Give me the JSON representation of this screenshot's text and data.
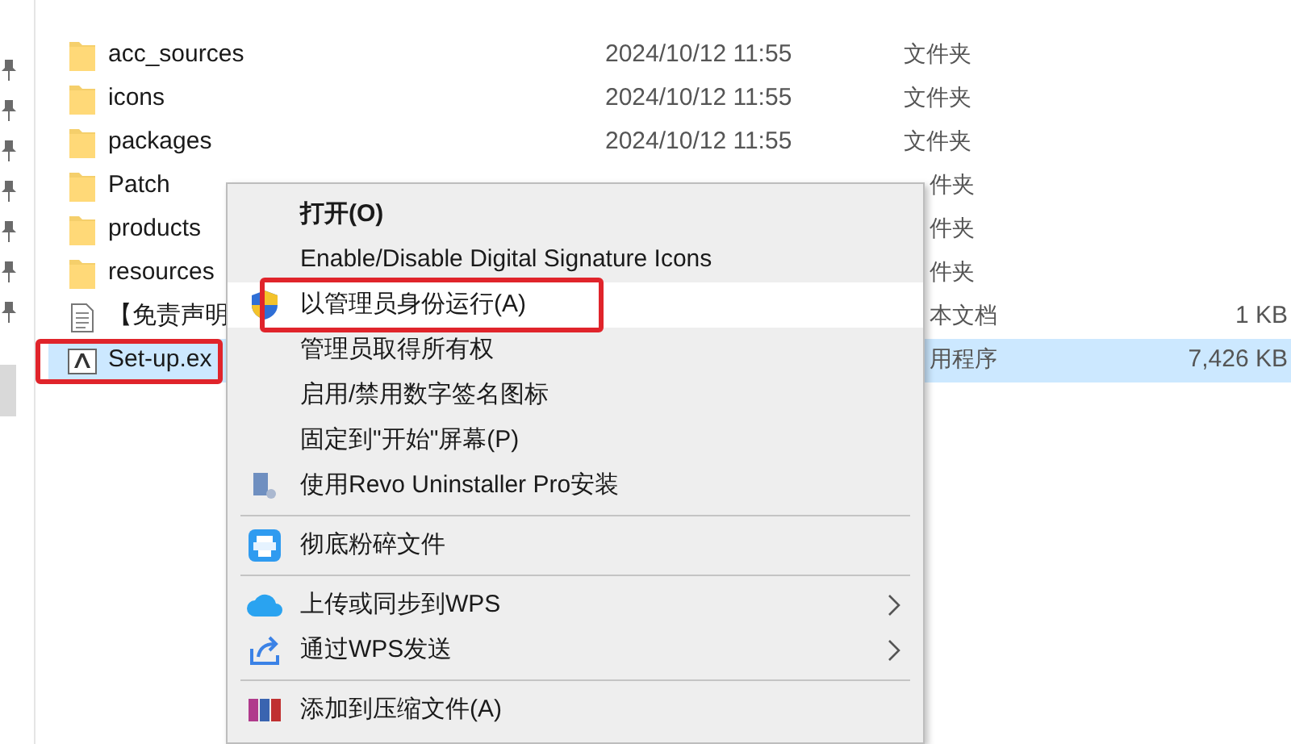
{
  "files": [
    {
      "kind": "folder",
      "name": "acc_sources",
      "date": "2024/10/12 11:55",
      "type": "文件夹",
      "selected": false,
      "highlighted": false
    },
    {
      "kind": "folder",
      "name": "icons",
      "date": "2024/10/12 11:55",
      "type": "文件夹",
      "selected": false,
      "highlighted": false
    },
    {
      "kind": "folder",
      "name": "packages",
      "date": "2024/10/12 11:55",
      "type": "文件夹",
      "selected": false,
      "highlighted": false
    },
    {
      "kind": "folder",
      "name": "Patch",
      "type": "件夹",
      "selected": false,
      "highlighted": false
    },
    {
      "kind": "folder",
      "name": "products",
      "type": "件夹",
      "selected": false,
      "highlighted": false
    },
    {
      "kind": "folder",
      "name": "resources",
      "type": "件夹",
      "selected": false,
      "highlighted": false
    },
    {
      "kind": "text",
      "name": "【免责声明",
      "type": "本文档",
      "size": "1 KB",
      "selected": false,
      "highlighted": false
    },
    {
      "kind": "app",
      "name": "Set-up.ex",
      "type": "用程序",
      "size": "7,426 KB",
      "selected": true,
      "highlighted": true
    }
  ],
  "context_menu": [
    {
      "kind": "plain",
      "label": "打开(O)",
      "default": true,
      "selected": false,
      "highlighted": false,
      "submenu": false
    },
    {
      "kind": "plain",
      "label": "Enable/Disable Digital Signature Icons",
      "default": false,
      "selected": false,
      "highlighted": false,
      "submenu": false
    },
    {
      "kind": "shield",
      "label": "以管理员身份运行(A)",
      "default": false,
      "selected": true,
      "highlighted": true,
      "submenu": false
    },
    {
      "kind": "plain",
      "label": "管理员取得所有权",
      "default": false,
      "selected": false,
      "highlighted": false,
      "submenu": false
    },
    {
      "kind": "plain",
      "label": "启用/禁用数字签名图标",
      "default": false,
      "selected": false,
      "highlighted": false,
      "submenu": false
    },
    {
      "kind": "plain",
      "label": "固定到\"开始\"屏幕(P)",
      "default": false,
      "selected": false,
      "highlighted": false,
      "submenu": false
    },
    {
      "kind": "installer",
      "label": "使用Revo Uninstaller Pro安装",
      "default": false,
      "selected": false,
      "highlighted": false,
      "submenu": false
    },
    {
      "kind": "separator"
    },
    {
      "kind": "shredder",
      "label": "彻底粉碎文件",
      "default": false,
      "selected": false,
      "highlighted": false,
      "submenu": false
    },
    {
      "kind": "separator"
    },
    {
      "kind": "cloud",
      "label": "上传或同步到WPS",
      "submenu": true,
      "default": false,
      "selected": false,
      "highlighted": false
    },
    {
      "kind": "share",
      "label": "通过WPS发送",
      "submenu": true,
      "default": false,
      "selected": false,
      "highlighted": false
    },
    {
      "kind": "separator"
    },
    {
      "kind": "archive",
      "label": "添加到压缩文件(A)",
      "default": false,
      "selected": false,
      "highlighted": false,
      "submenu": false
    }
  ]
}
